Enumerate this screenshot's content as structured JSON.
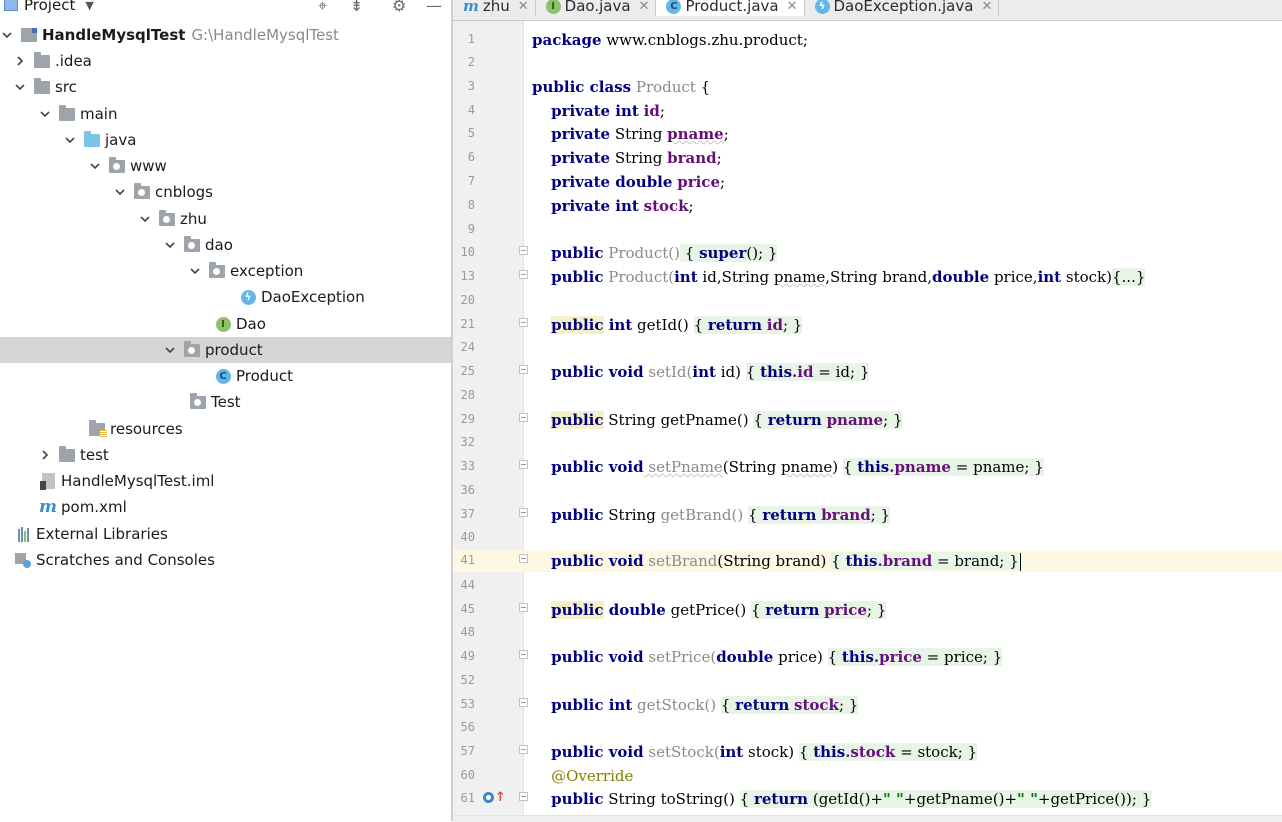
{
  "project_panel": {
    "title": "Project",
    "header_icons": [
      "locate-icon",
      "collapse-icon",
      "gear-icon",
      "hide-icon"
    ],
    "tree": [
      {
        "label": "HandleMysqlTest",
        "path": "G:\\HandleMysqlTest",
        "icon": "module-folder-icon",
        "expanded": true
      },
      {
        "label": ".idea",
        "icon": "folder-icon",
        "expanded": false
      },
      {
        "label": "src",
        "icon": "folder-icon",
        "expanded": true
      },
      {
        "label": "main",
        "icon": "folder-icon",
        "expanded": true
      },
      {
        "label": "java",
        "icon": "source-folder-icon",
        "expanded": true
      },
      {
        "label": "www",
        "icon": "package-icon",
        "expanded": true
      },
      {
        "label": "cnblogs",
        "icon": "package-icon",
        "expanded": true
      },
      {
        "label": "zhu",
        "icon": "package-icon",
        "expanded": true
      },
      {
        "label": "dao",
        "icon": "package-icon",
        "expanded": true
      },
      {
        "label": "exception",
        "icon": "package-icon",
        "expanded": true
      },
      {
        "label": "DaoException",
        "icon": "exception-class-icon"
      },
      {
        "label": "Dao",
        "icon": "interface-icon"
      },
      {
        "label": "product",
        "icon": "package-icon",
        "expanded": true,
        "selected": true
      },
      {
        "label": "Product",
        "icon": "class-icon"
      },
      {
        "label": "Test",
        "icon": "package-icon"
      },
      {
        "label": "resources",
        "icon": "resources-folder-icon"
      },
      {
        "label": "test",
        "icon": "folder-icon",
        "expanded": false
      },
      {
        "label": "HandleMysqlTest.iml",
        "icon": "iml-file-icon"
      },
      {
        "label": "pom.xml",
        "icon": "maven-icon"
      },
      {
        "label": "External Libraries",
        "icon": "libraries-icon"
      },
      {
        "label": "Scratches and Consoles",
        "icon": "scratches-icon"
      }
    ]
  },
  "tabs": [
    {
      "label": "zhu",
      "icon": "maven-icon",
      "active": false
    },
    {
      "label": "Dao.java",
      "icon": "interface-icon",
      "active": false
    },
    {
      "label": "Product.java",
      "icon": "class-icon",
      "active": true
    },
    {
      "label": "DaoException.java",
      "icon": "exception-class-icon",
      "active": false
    }
  ],
  "editor": {
    "current_line": "41",
    "line_numbers": [
      "1",
      "2",
      "3",
      "4",
      "5",
      "6",
      "7",
      "8",
      "9",
      "10",
      "13",
      "20",
      "21",
      "24",
      "25",
      "28",
      "29",
      "32",
      "33",
      "36",
      "37",
      "40",
      "41",
      "44",
      "45",
      "48",
      "49",
      "52",
      "53",
      "56",
      "57",
      "60",
      "61"
    ],
    "code": {
      "l1_kw": "package",
      "l1_rest": " www.cnblogs.zhu.product;",
      "l3_kw": "public class",
      "l3_name": " Product",
      "l3_rest": " {",
      "l4_kw": "private int",
      "l4_fld": "id",
      "l4_end": ";",
      "l5_kw": "private",
      "l5_type": " String ",
      "l5_fld": "pname",
      "l5_end": ";",
      "l6_kw": "private",
      "l6_type": " String ",
      "l6_fld": "brand",
      "l6_end": ";",
      "l7_kw": "private double",
      "l7_fld": "price",
      "l7_end": ";",
      "l8_kw": "private int",
      "l8_fld": "stock",
      "l8_end": ";",
      "l10_kw": "public",
      "l10_name": " Product()",
      "l10_open": " {",
      "l10_super": "super",
      "l10_call": "();",
      "l10_close": "}",
      "l13_kw": "public",
      "l13_name": " Product(",
      "l13_p1": "int",
      "l13_p1n": " id,String ",
      "l13_pname": "pname",
      "l13_p2": ",String brand,",
      "l13_p3": "double",
      "l13_p3n": " price,",
      "l13_p4": "int",
      "l13_p4n": " stock)",
      "l13_fold": "{...}",
      "l21_pub": "public",
      "l21_type": " int",
      "l21_name": " getId()",
      "l21_ret": "return",
      "l21_fld": "id",
      "l21_end": ";",
      "l25_kw": "public void",
      "l25_name": " setId(",
      "l25_pt": "int",
      "l25_pn": " id)",
      "l25_this": "this",
      "l25_fld": ".id",
      "l25_asg": " = id;",
      "l29_pub": "public",
      "l29_type": " String getPname()",
      "l29_ret": "return",
      "l29_fld": "pname",
      "l29_end": ";",
      "l33_kw": "public void",
      "l33_name": " setPname",
      "l33_args": "(String ",
      "l33_pn": "pname",
      "l33_close": ")",
      "l33_this": "this",
      "l33_fld": ".pname",
      "l33_asg": " = pname;",
      "l37_kw": "public",
      "l37_type": " String",
      "l37_name": " getBrand()",
      "l37_ret": "return",
      "l37_fld": "brand",
      "l37_end": ";",
      "l41_kw": "public void",
      "l41_name": " setBrand",
      "l41_args": "(String brand)",
      "l41_this": "this",
      "l41_fld": ".brand",
      "l41_asg": " = brand;",
      "l45_pub": "public",
      "l45_type": " double",
      "l45_name": " getPrice()",
      "l45_ret": "return",
      "l45_fld": "price",
      "l45_end": ";",
      "l49_kw": "public void",
      "l49_name": " setPrice(",
      "l49_pt": "double",
      "l49_pn": " price)",
      "l49_this": "this",
      "l49_fld": ".price",
      "l49_asg": " = price;",
      "l53_kw": "public int",
      "l53_name": " getStock()",
      "l53_ret": "return",
      "l53_fld": "stock",
      "l53_end": ";",
      "l57_kw": "public void",
      "l57_name": " setStock(",
      "l57_pt": "int",
      "l57_pn": " stock)",
      "l57_this": "this",
      "l57_fld": ".stock",
      "l57_asg": " = stock;",
      "l60_ann": "@Override",
      "l61_kw": "public",
      "l61_type": " String toString()",
      "l61_ret": "return",
      "l61_a": " (getId()+",
      "l61_s1": "\" \"",
      "l61_b": "+getPname()+",
      "l61_s2": "\" \"",
      "l61_c": "+getPrice());",
      "l61_close": "}",
      "brace_open": "{",
      "brace_close": "}"
    }
  }
}
